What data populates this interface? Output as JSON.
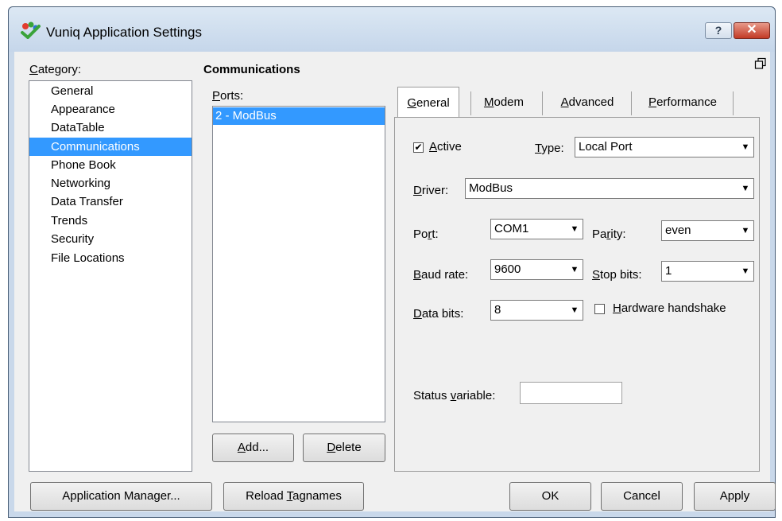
{
  "window": {
    "title": "Vuniq Application Settings",
    "help_label": "?",
    "close_label": "✕"
  },
  "category": {
    "label_u": "C",
    "label_rest": "ategory:",
    "items": [
      "General",
      "Appearance",
      "DataTable",
      "Communications",
      "Phone Book",
      "Networking",
      "Data Transfer",
      "Trends",
      "Security",
      "File Locations"
    ],
    "selected": "Communications"
  },
  "panel": {
    "title": "Communications"
  },
  "ports": {
    "label_u": "P",
    "label_rest": "orts:",
    "items": [
      "2 - ModBus"
    ],
    "add_u": "A",
    "add_rest": "dd...",
    "delete_u": "D",
    "delete_rest": "elete"
  },
  "tabs": [
    {
      "u": "G",
      "rest": "eneral"
    },
    {
      "u": "M",
      "rest": "odem"
    },
    {
      "u": "A",
      "rest": "dvanced"
    },
    {
      "u": "P",
      "rest": "erformance"
    }
  ],
  "general": {
    "active_pre": "",
    "active_u": "A",
    "active_rest": "ctive",
    "active_checked": "✔",
    "type_u": "T",
    "type_rest": "ype:",
    "type_value": "Local Port",
    "driver_u": "D",
    "driver_rest": "river:",
    "driver_value": "ModBus",
    "port_pre": "Po",
    "port_u": "r",
    "port_rest": "t:",
    "port_value": "COM1",
    "parity_pre": "Pa",
    "parity_u": "r",
    "parity_rest": "ity:",
    "parity_value": "even",
    "baud_u": "B",
    "baud_rest": "aud rate:",
    "baud_value": "9600",
    "stop_u": "S",
    "stop_rest": "top bits:",
    "stop_value": "1",
    "databits_u": "D",
    "databits_rest": "ata bits:",
    "databits_value": "8",
    "hw_u": "H",
    "hw_rest": "ardware handshake",
    "status_pre": "Status ",
    "status_u": "v",
    "status_rest": "ariable:",
    "status_value": ""
  },
  "footer": {
    "app_manager": "Application Manager...",
    "reload_pre": "Reload ",
    "reload_u": "T",
    "reload_rest": "agnames",
    "ok": "OK",
    "cancel": "Cancel",
    "apply": "Apply"
  },
  "colors": {
    "selection": "#3399ff",
    "close_button": "#c23b26",
    "titlebar": "#c9d8ea"
  }
}
